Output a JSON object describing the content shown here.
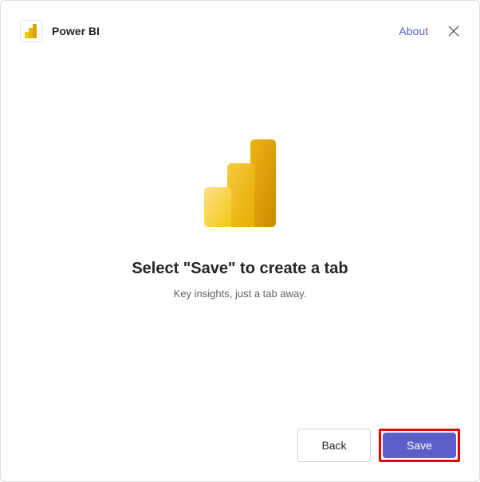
{
  "header": {
    "app_title": "Power BI",
    "about_label": "About"
  },
  "content": {
    "heading": "Select \"Save\" to create a tab",
    "subheading": "Key insights, just a tab away."
  },
  "footer": {
    "back_label": "Back",
    "save_label": "Save"
  },
  "colors": {
    "accent": "#5b5fc7",
    "highlight": "#e60000"
  }
}
